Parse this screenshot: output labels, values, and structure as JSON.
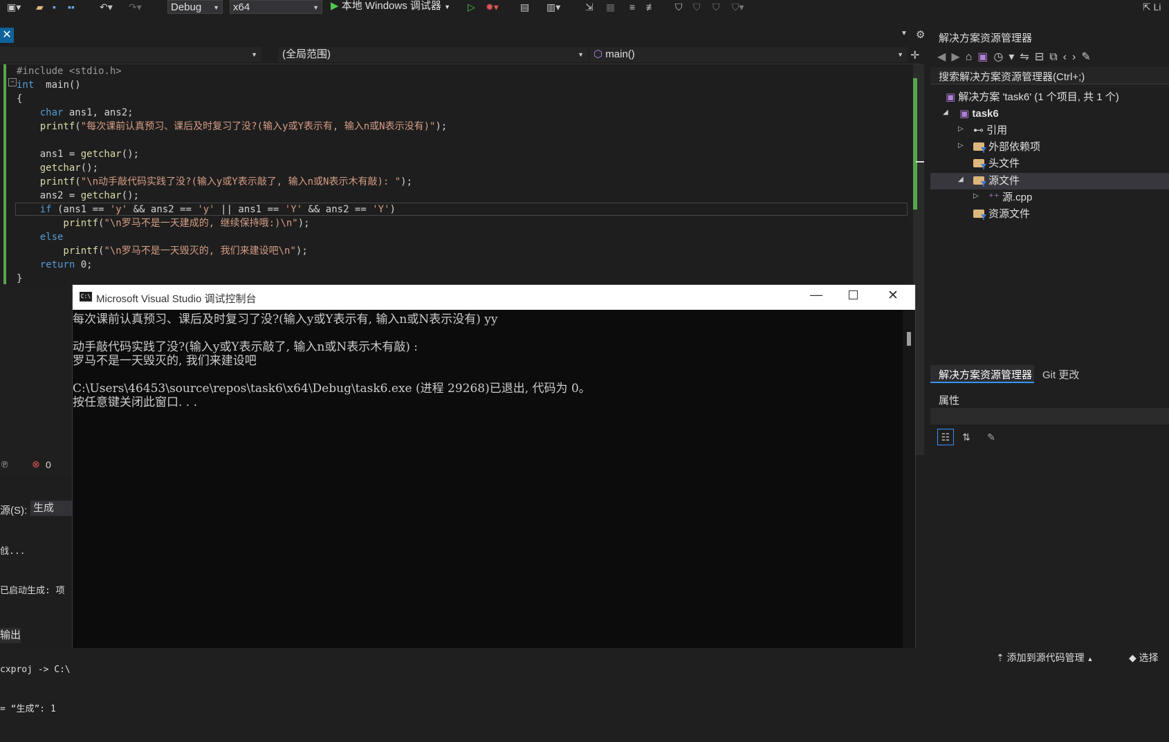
{
  "toolbar": {
    "config": "Debug",
    "platform": "x64",
    "debugger": "本地 Windows 调试器",
    "right_label": "Li"
  },
  "nav": {
    "project_scope": "(全局范围)",
    "function": "main()"
  },
  "code": [
    {
      "parts": [
        [
          "pp",
          "#include <stdio.h>"
        ]
      ]
    },
    {
      "parts": [
        [
          "kw",
          "int"
        ],
        [
          "",
          "  main()"
        ]
      ]
    },
    {
      "parts": [
        [
          "",
          "{"
        ]
      ]
    },
    {
      "parts": [
        [
          "kw",
          "    char"
        ],
        [
          "",
          " ans1, ans2;"
        ]
      ]
    },
    {
      "parts": [
        [
          "fn",
          "    printf"
        ],
        [
          "",
          "("
        ],
        [
          "str",
          "\"每次课前认真预习、课后及时复习了没?(输入y或Y表示有, 输入n或N表示没有)\""
        ],
        [
          "",
          ");"
        ]
      ]
    },
    {
      "parts": [
        [
          "",
          ""
        ]
      ]
    },
    {
      "parts": [
        [
          "",
          "    ans1 = "
        ],
        [
          "fn",
          "getchar"
        ],
        [
          "",
          "();"
        ]
      ]
    },
    {
      "parts": [
        [
          "fn",
          "    getchar"
        ],
        [
          "",
          "();"
        ]
      ]
    },
    {
      "parts": [
        [
          "fn",
          "    printf"
        ],
        [
          "",
          "("
        ],
        [
          "str",
          "\"\\n动手敲代码实践了没?(输入y或Y表示敲了, 输入n或N表示木有敲): \""
        ],
        [
          "",
          ");"
        ]
      ]
    },
    {
      "parts": [
        [
          "",
          "    ans2 = "
        ],
        [
          "fn",
          "getchar"
        ],
        [
          "",
          "();"
        ]
      ]
    },
    {
      "parts": [
        [
          "kw",
          "    if"
        ],
        [
          "",
          " (ans1 == "
        ],
        [
          "str",
          "'y'"
        ],
        [
          "",
          " && ans2 == "
        ],
        [
          "str",
          "'y'"
        ],
        [
          "",
          " || ans1 == "
        ],
        [
          "str",
          "'Y'"
        ],
        [
          "",
          " && ans2 == "
        ],
        [
          "str",
          "'Y'"
        ],
        [
          "",
          ")"
        ]
      ]
    },
    {
      "parts": [
        [
          "fn",
          "        printf"
        ],
        [
          "",
          "("
        ],
        [
          "str",
          "\"\\n罗马不是一天建成的, 继续保持哦:)\\n\""
        ],
        [
          "",
          ");"
        ]
      ]
    },
    {
      "parts": [
        [
          "kw",
          "    else"
        ]
      ]
    },
    {
      "parts": [
        [
          "fn",
          "        printf"
        ],
        [
          "",
          "("
        ],
        [
          "str",
          "\"\\n罗马不是一天毁灭的, 我们来建设吧\\n\""
        ],
        [
          "",
          ");"
        ]
      ]
    },
    {
      "parts": [
        [
          "kw",
          "    return"
        ],
        [
          "",
          " 0;"
        ]
      ]
    },
    {
      "parts": [
        [
          "",
          "}"
        ]
      ]
    }
  ],
  "errors": {
    "count": "0"
  },
  "output": {
    "source_label": "源(S):",
    "source_value": "生成",
    "lines": [
      "戗...",
      "已启动生成: 项",
      "",
      "cxproj -> C:\\",
      "= “生成”: 1"
    ],
    "tab": "输出"
  },
  "console": {
    "title": "Microsoft Visual Studio 调试控制台",
    "lines": [
      "每次课前认真预习、课后及时复习了没?(输入y或Y表示有, 输入n或N表示没有) yy",
      "",
      "动手敲代码实践了没?(输入y或Y表示敲了, 输入n或N表示木有敲) :",
      "罗马不是一天毁灭的, 我们来建设吧",
      "",
      "C:\\Users\\46453\\source\\repos\\task6\\x64\\Debug\\task6.exe (进程 29268)已退出, 代码为 0。",
      "按任意键关闭此窗口. . ."
    ]
  },
  "solution_explorer": {
    "title": "解决方案资源管理器",
    "search_placeholder": "搜索解决方案资源管理器(Ctrl+;)",
    "solution": "解决方案 'task6' (1 个项目, 共 1 个)",
    "project": "task6",
    "items": [
      "引用",
      "外部依赖项",
      "头文件",
      "源文件",
      "源.cpp",
      "资源文件"
    ],
    "tabs": [
      "解决方案资源管理器",
      "Git 更改"
    ]
  },
  "properties": {
    "title": "属性"
  },
  "status": {
    "add_source": "添加到源代码管理",
    "select": "选择"
  },
  "colors": {
    "accent_green": "#57a64a",
    "keyword": "#569cd6",
    "string": "#d69d85"
  }
}
